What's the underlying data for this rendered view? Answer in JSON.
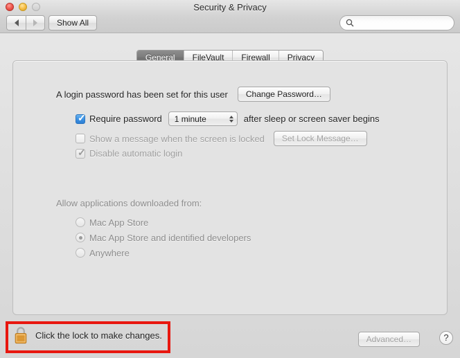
{
  "window": {
    "title": "Security & Privacy",
    "controls": {
      "close": "close-button",
      "minimize": "minimize-button",
      "zoom": "zoom-button"
    }
  },
  "toolbar": {
    "back_label": "◀",
    "forward_label": "▶",
    "show_all_label": "Show All",
    "search": {
      "value": "",
      "placeholder": ""
    }
  },
  "tabs": [
    {
      "label": "General",
      "selected": true
    },
    {
      "label": "FileVault",
      "selected": false
    },
    {
      "label": "Firewall",
      "selected": false
    },
    {
      "label": "Privacy",
      "selected": false
    }
  ],
  "general": {
    "login_password_text": "A login password has been set for this user",
    "change_password_label": "Change Password…",
    "require_password": {
      "checked": true,
      "enabled": true,
      "label": "Require password",
      "delay_value": "1 minute",
      "suffix": "after sleep or screen saver begins"
    },
    "show_message": {
      "checked": false,
      "enabled": false,
      "label": "Show a message when the screen is locked",
      "button_label": "Set Lock Message…"
    },
    "disable_automatic_login": {
      "checked": true,
      "enabled": false,
      "label": "Disable automatic login"
    },
    "allow_apps": {
      "heading": "Allow applications downloaded from:",
      "options": [
        {
          "label": "Mac App Store",
          "selected": false
        },
        {
          "label": "Mac App Store and identified developers",
          "selected": true
        },
        {
          "label": "Anywhere",
          "selected": false
        }
      ]
    }
  },
  "footer": {
    "lock_text": "Click the lock to make changes.",
    "lock_state": "locked",
    "advanced_label": "Advanced…",
    "help_label": "?"
  },
  "annotation": {
    "highlight_color": "#e8170f"
  }
}
